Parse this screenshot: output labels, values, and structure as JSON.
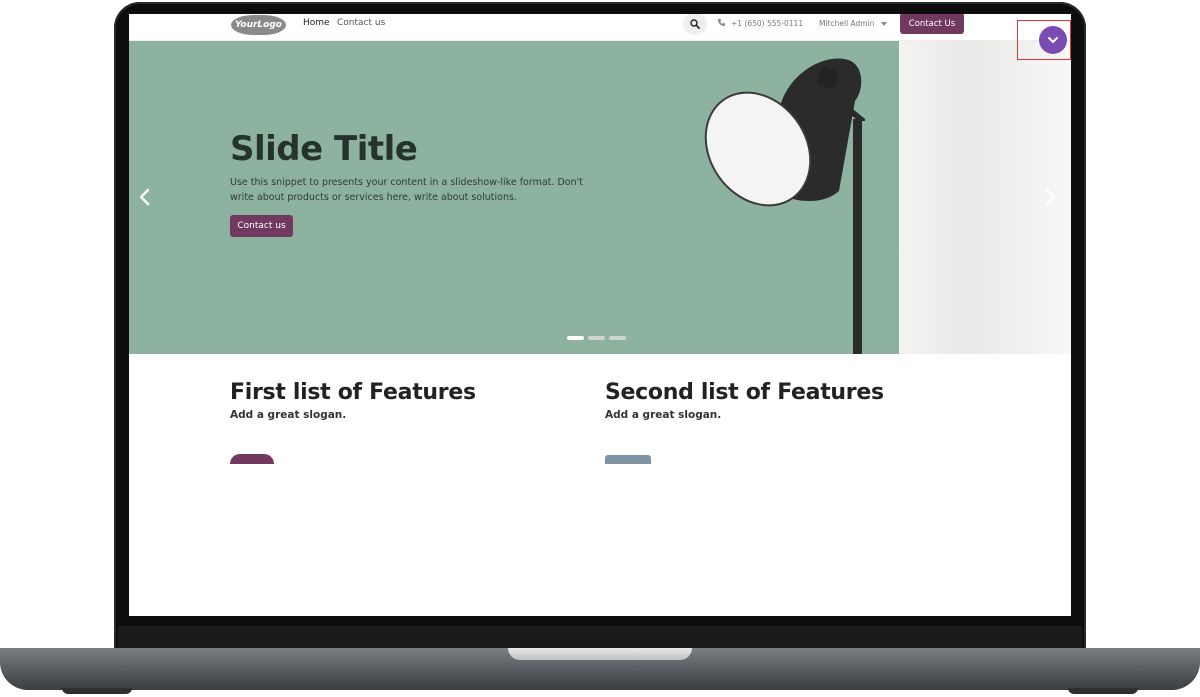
{
  "header": {
    "logo_text": "YourLogo",
    "nav": {
      "home": "Home",
      "contact": "Contact us"
    },
    "phone": "+1 (650) 555-0111",
    "user": "Mitchell Admin",
    "cta_label": "Contact Us"
  },
  "hero": {
    "title": "Slide Title",
    "text": "Use this snippet to presents your content in a slideshow-like format. Don't write about products or services here, write about solutions.",
    "button": "Contact us",
    "slides": 3,
    "active_slide": 1
  },
  "features": [
    {
      "title": "First list of Features",
      "slogan": "Add a great slogan."
    },
    {
      "title": "Second list of Features",
      "slogan": "Add a great slogan."
    }
  ],
  "colors": {
    "brand": "#71395f",
    "toggle": "#7b4ab3",
    "highlight": "#e0353a",
    "hero_bg": "#8eb2a0"
  },
  "icons": {
    "search": "search-icon",
    "phone": "phone-icon",
    "prev": "chevron-left-icon",
    "next": "chevron-right-icon",
    "toggle": "chevron-down-icon"
  }
}
